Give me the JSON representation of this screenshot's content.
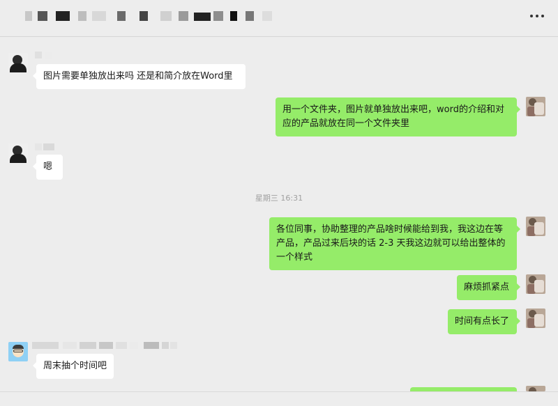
{
  "chat": {
    "time_separator": "星期三 16:31",
    "messages": [
      {
        "side": "in",
        "text": "图片需要单独放出来吗 还是和简介放在Word里"
      },
      {
        "side": "out",
        "text": "用一个文件夹，图片就单独放出来吧，word的介绍和对应的产品就放在同一个文件夹里"
      },
      {
        "side": "in",
        "text": "嗯"
      },
      {
        "side": "out",
        "text": "各位同事，协助整理的产品啥时候能给到我，我这边在等产品，产品过来后块的话 2-3 天我这边就可以给出整体的一个样式"
      },
      {
        "side": "out",
        "text": "麻烦抓紧点"
      },
      {
        "side": "out",
        "text": "时间有点长了"
      },
      {
        "side": "in",
        "text": "周末抽个时间吧"
      }
    ]
  },
  "colors": {
    "background": "#ededed",
    "incoming_bubble": "#ffffff",
    "outgoing_bubble": "#95ec69"
  },
  "icons": [
    "more-icon",
    "avatar-bw",
    "avatar-me",
    "avatar-cartoon"
  ]
}
